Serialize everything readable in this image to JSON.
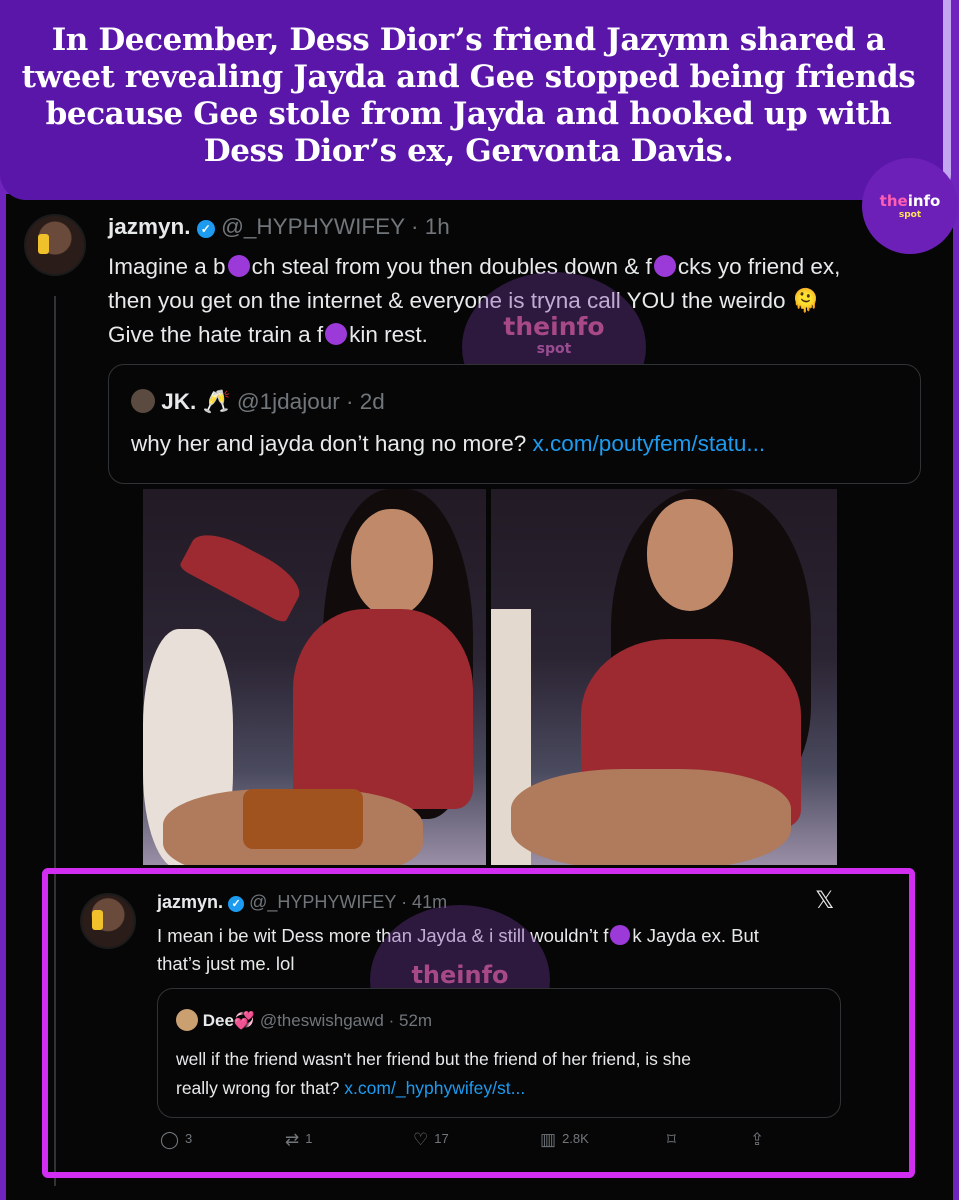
{
  "banner": {
    "headline": "In December, Dess Dior’s friend Jazymn shared a tweet revealing Jayda and Gee stopped being friends because Gee stole from Jayda and hooked up with Dess Dior’s ex, Gervonta Davis."
  },
  "brand": {
    "the": "the",
    "info": "info",
    "spot": "spot",
    "color_primary": "#6f25bd",
    "color_pink": "#ff5eb4",
    "color_yellow": "#ffe15a",
    "highlight": "#d22ef2"
  },
  "tweet1": {
    "name": "jazmyn.",
    "handle": "@_HYPHYWIFEY",
    "time": "· 1h",
    "line1_a": "Imagine a b",
    "line1_b": "ch steal from you then doubles down & f",
    "line1_c": "cks yo friend ex,",
    "line2": "then you get on the internet & everyone is tryna call YOU the weirdo 🫠",
    "line3_a": "Give the hate train a f",
    "line3_b": "kin rest.",
    "quote": {
      "name": "JK. 🥂",
      "handle": "@1jdajour",
      "time": "· 2d",
      "text": "why her and jayda don’t hang no more?",
      "link": "x.com/poutyfem/statu..."
    }
  },
  "tweet2": {
    "name": "jazmyn.",
    "handle": "@_HYPHYWIFEY",
    "time": "· 41m",
    "x_logo": "𝕏",
    "line1_a": "I mean i be wit Dess more than Jayda & i still wouldn’t f",
    "line1_b": "k Jayda ex. But",
    "line2": "that’s just me. lol",
    "quote": {
      "name": "Dee💞",
      "handle": "@theswishgawd",
      "time": "· 52m",
      "line1": "well if the friend wasn't her friend but the friend of her friend, is she",
      "line2": "really wrong for that?",
      "link": "x.com/_hyphywifey/st..."
    },
    "actions": {
      "replies": "3",
      "reposts": "1",
      "likes": "17",
      "views": "2.8K"
    }
  },
  "icons": {
    "verified": "verified-badge-icon",
    "reply": "reply-icon",
    "repost": "repost-icon",
    "like": "heart-icon",
    "views": "views-icon",
    "bookmark": "bookmark-icon",
    "share": "share-icon"
  }
}
